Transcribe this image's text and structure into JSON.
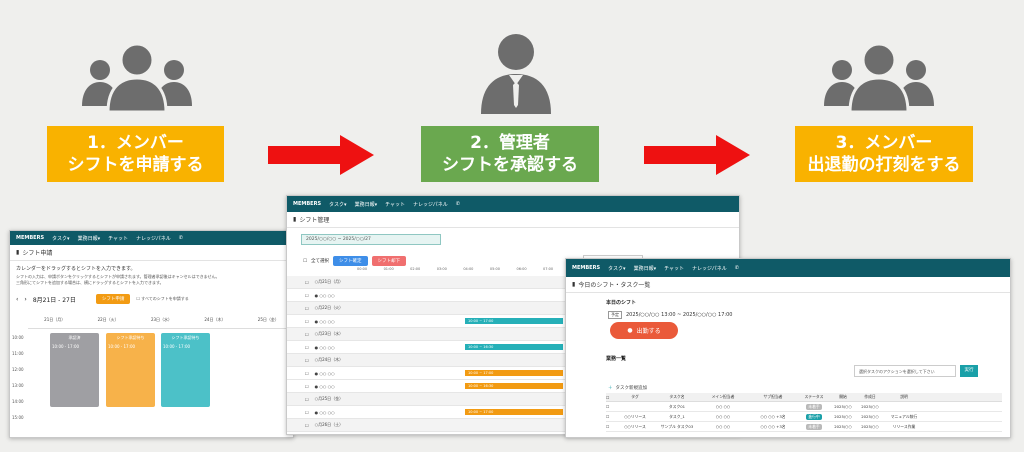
{
  "steps": [
    {
      "line1": "1．メンバー",
      "line2": "シフトを申請する",
      "color": "#f9b200"
    },
    {
      "line1": "2．管理者",
      "line2": "シフトを承認する",
      "color": "#6aa84f"
    },
    {
      "line1": "3．メンバー",
      "line2": "出退勤の打刻をする",
      "color": "#f9b200"
    }
  ],
  "colors": {
    "header": "#0f5a67",
    "arrow": "#ee1111",
    "person": "#6d6d6d"
  },
  "nav": {
    "logo": "MEMBERS",
    "tasks": "タスク▾",
    "work": "業務日報▾",
    "chat": "チャット",
    "knowledge": "ナレッジパネル"
  },
  "shot1": {
    "title": "シフト申請",
    "help1": "カレンダーをドラッグするとシフトを入力できます。",
    "help2": "シフトの入力は、申請ボタンをクリックするとシフトが申請されます。管理者承認後はキャンセルはできません。",
    "help3": "三角形にてシフトを追加する場合は、横にドラッグするとシフトを入力できます。",
    "range": "8月21日 - 27日",
    "apply": "シフト申請",
    "apply_all": "すべてのシフトを申請する",
    "days": [
      "21日（月）",
      "22日（火）",
      "23日（水）",
      "24日（木）",
      "25日（金）"
    ],
    "times": [
      "10:00",
      "11:00",
      "12:00",
      "13:00",
      "14:00",
      "15:00"
    ],
    "events": [
      {
        "label": "承認済",
        "time": "10:00 - 17:00"
      },
      {
        "label": "シフト承認待ち",
        "time": "10:00 - 17:00"
      },
      {
        "label": "シフト承認待ち",
        "time": "10:00 - 17:00"
      }
    ]
  },
  "shot2": {
    "title": "シフト管理",
    "date": "2025/○○/○○ ~ 2025/○○/27",
    "select_all": "全て選択",
    "confirm": "シフト確定",
    "reject": "シフト却下",
    "group": "グループを選択",
    "hours": [
      "00:00",
      "01:00",
      "02:00",
      "03:00",
      "04:00",
      "05:00",
      "06:00",
      "07:00",
      "08:00",
      "09:00",
      "10:00",
      "11:00",
      "12:00",
      "13:00"
    ],
    "rows": [
      {
        "label": "○月21日（月）",
        "type": "day"
      },
      {
        "label": "● ○○ ○○",
        "type": "member"
      },
      {
        "label": "○月22日（火）",
        "type": "day"
      },
      {
        "label": "● ○○ ○○",
        "type": "member",
        "bar": "10:00 ~ 17:00",
        "color": "#26b0b8"
      },
      {
        "label": "○月23日（水）",
        "type": "day"
      },
      {
        "label": "● ○○ ○○",
        "type": "member",
        "bar": "10:00 ~ 16:30",
        "color": "#26b0b8"
      },
      {
        "label": "○月24日（木）",
        "type": "day"
      },
      {
        "label": "● ○○ ○○",
        "type": "member",
        "bar": "10:00 ~ 17:00",
        "color": "#f29b13"
      },
      {
        "label": "● ○○ ○○",
        "type": "member",
        "bar": "10:00 ~ 16:30",
        "color": "#f29b13"
      },
      {
        "label": "○月25日（金）",
        "type": "day"
      },
      {
        "label": "● ○○ ○○",
        "type": "member",
        "bar": "10:00 ~ 17:00",
        "color": "#f29b13"
      },
      {
        "label": "○月26日（土）",
        "type": "day"
      }
    ]
  },
  "shot3": {
    "title": "今日のシフト・タスク一覧",
    "today": "本日のシフト",
    "plan_tag": "予定",
    "plan": "2025/○○/○○ 13:00 ~ 2025/○○/○○ 17:00",
    "clock_in": "出勤する",
    "task_title": "業務一覧",
    "action_ph": "選択タスクのアクションを選択して下さい",
    "run": "実行",
    "new_task": "タスク新規追加",
    "columns": [
      "タグ",
      "タスク名",
      "メイン担当者",
      "サブ担当者",
      "ステータス",
      "開始",
      "作成日",
      "説明"
    ],
    "rows": [
      {
        "tag": "",
        "name": "タスク01",
        "main": "○○ ○○",
        "sub": "",
        "status": "未着手",
        "start": "2025/○○",
        "created": "2025/○○",
        "desc": ""
      },
      {
        "tag": "○○リリース",
        "name": "タスク_1",
        "main": "○○ ○○",
        "sub": "○○ ○○ +3名",
        "status": "進行中",
        "start": "2025/○○",
        "created": "2025/○○",
        "desc": "マニュアル執行"
      },
      {
        "tag": "○○リリース",
        "name": "サンプル タスク03",
        "main": "○○ ○○",
        "sub": "○○ ○○ +3名",
        "status": "未着手",
        "start": "2025/○○",
        "created": "2025/○○",
        "desc": "リリース作業"
      }
    ]
  }
}
